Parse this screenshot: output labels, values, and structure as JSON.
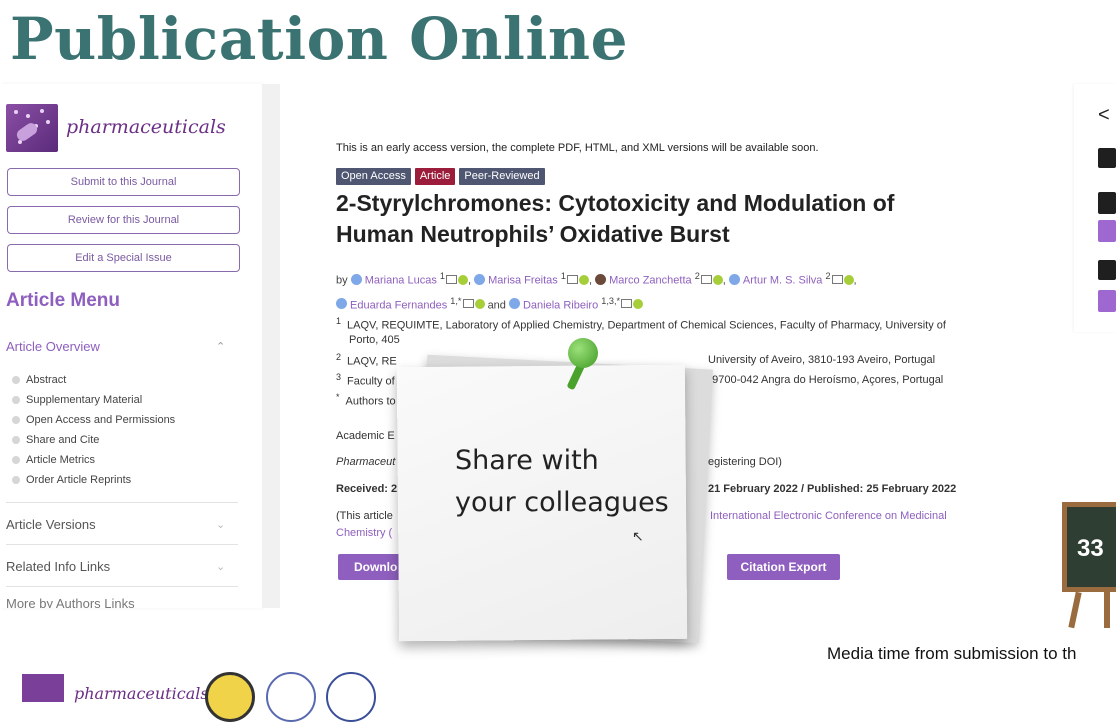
{
  "slide": {
    "title": "Publication Online",
    "caption": "Media time from submission to th"
  },
  "journal": {
    "name": "pharmaceuticals"
  },
  "sidebar": {
    "buttons": [
      "Submit to this Journal",
      "Review for this Journal",
      "Edit a Special Issue"
    ],
    "menu_title": "Article Menu",
    "overview": "Article Overview",
    "items": [
      "Abstract",
      "Supplementary Material",
      "Open Access and Permissions",
      "Share and Cite",
      "Article Metrics",
      "Order Article Reprints"
    ],
    "sections": [
      "Article Versions",
      "Related Info Links",
      "More by Authors Links"
    ]
  },
  "article": {
    "notice": "This is an early access version, the complete PDF, HTML, and XML versions will be available soon.",
    "tags": [
      "Open Access",
      "Article",
      "Peer-Reviewed"
    ],
    "title": "2-Styrylchromones: Cytotoxicity and Modulation of Human Neutrophils’ Oxidative Burst",
    "by": "by",
    "authors": [
      {
        "name": "Mariana Lucas",
        "sup": "1"
      },
      {
        "name": "Marisa Freitas",
        "sup": "1"
      },
      {
        "name": "Marco Zanchetta",
        "sup": "2"
      },
      {
        "name": "Artur M. S. Silva",
        "sup": "2"
      },
      {
        "name": "Eduarda Fernandes",
        "sup": "1,*"
      },
      {
        "name": "Daniela Ribeiro",
        "sup": "1,3,*"
      }
    ],
    "and": "and",
    "affiliations": [
      {
        "sup": "1",
        "text": "LAQV, REQUIMTE, Laboratory of Applied Chemistry, Department of Chemical Sciences, Faculty of Pharmacy, University of"
      },
      {
        "sup": "",
        "text": "Porto, 405"
      },
      {
        "sup": "2",
        "text": "LAQV, RE"
      },
      {
        "sup": "",
        "text": "University of Aveiro, 3810-193 Aveiro, Portugal"
      },
      {
        "sup": "3",
        "text": "Faculty of"
      },
      {
        "sup": "",
        "text": ", 9700-042 Angra do Heroísmo, Açores, Portugal"
      },
      {
        "sup": "*",
        "text": "Authors to"
      }
    ],
    "academic": "Academic E",
    "journal_ref": "Pharmaceut",
    "journal_ref_right": "egistering DOI)",
    "received": "Received: 2",
    "dates_right": "21 February 2022 / Published: 25 February 2022",
    "this_article": "(This article",
    "conference": "International Electronic Conference on Medicinal",
    "chemistry": "Chemistry (",
    "download_label": "Downlo",
    "citation_label": "Citation Export"
  },
  "note": {
    "line1": "Share with",
    "line2": "your colleagues"
  },
  "chalkboard": {
    "value": "33"
  }
}
